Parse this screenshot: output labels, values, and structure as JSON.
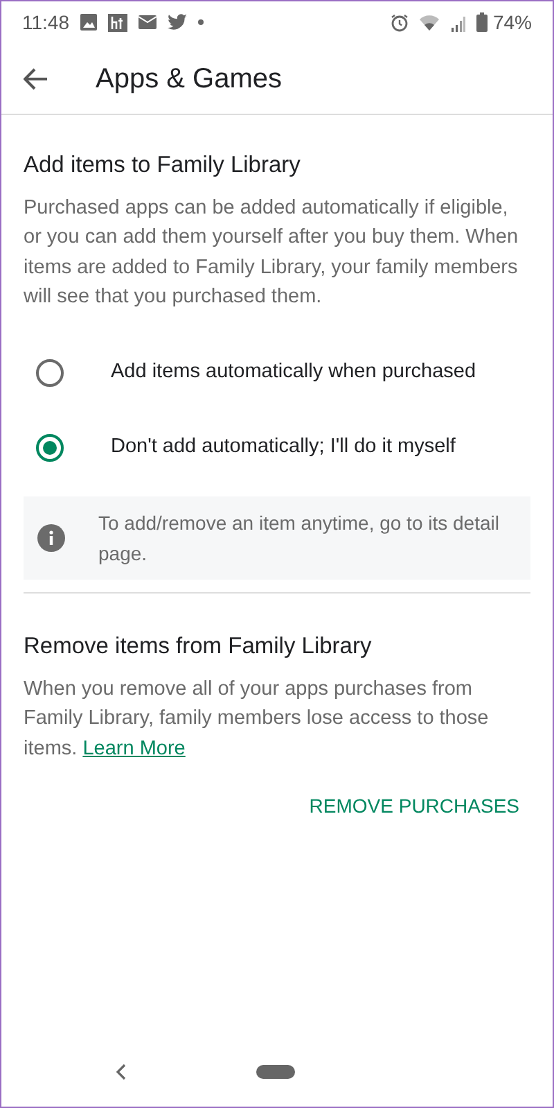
{
  "status_bar": {
    "time": "11:48",
    "battery": "74%"
  },
  "header": {
    "title": "Apps & Games"
  },
  "add_section": {
    "title": "Add items to Family Library",
    "description": "Purchased apps can be added automatically if eligible, or you can add them yourself after you buy them. When items are added to Family Library, your family members will see that you purchased them.",
    "options": [
      {
        "label": "Add items automatically when purchased",
        "selected": false
      },
      {
        "label": "Don't add automatically; I'll do it myself",
        "selected": true
      }
    ],
    "info": "To add/remove an item anytime, go to its detail page."
  },
  "remove_section": {
    "title": "Remove items from Family Library",
    "description": "When you remove all of your apps purchases from Family Library, family members lose access to those items.",
    "link": "Learn More",
    "button": "REMOVE PURCHASES"
  }
}
